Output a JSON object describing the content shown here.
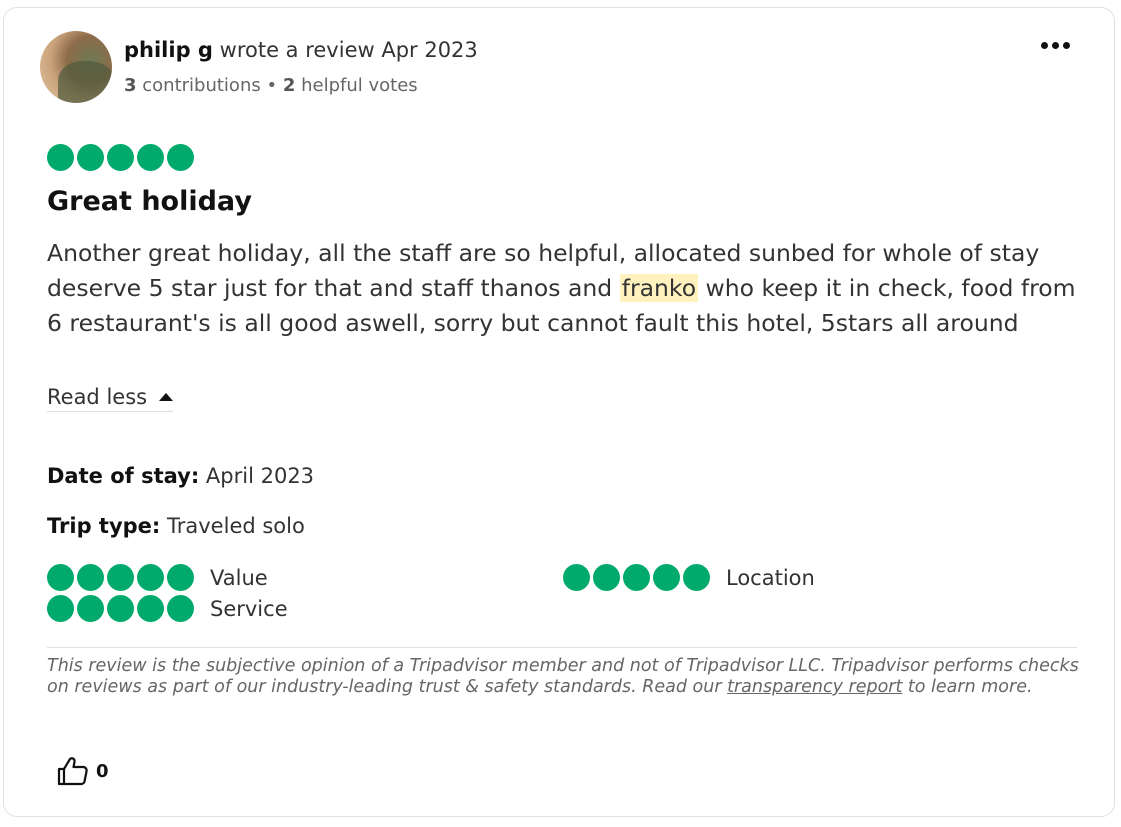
{
  "author": {
    "name": "philip g",
    "action": "wrote a review Apr 2023",
    "contributions_count": "3",
    "contributions_label": "contributions",
    "separator": "•",
    "helpful_votes_count": "2",
    "helpful_votes_label": "helpful votes",
    "avatar_icon": "user-avatar-photo"
  },
  "menu": {
    "icon": "more-options-icon"
  },
  "review": {
    "rating": 5,
    "rating_max": 5,
    "title": "Great holiday",
    "body_part1": "Another great holiday, all the staff are so helpful, allocated sunbed for whole of stay deserve 5 star just for that and staff thanos and ",
    "body_highlight": "franko",
    "body_part2": " who keep it in check, food from 6 restaurant's is all good aswell, sorry but cannot fault this hotel, 5stars all around",
    "read_less_label": "Read less"
  },
  "stay": {
    "date_label": "Date of stay:",
    "date_value": "April 2023",
    "trip_label": "Trip type:",
    "trip_value": "Traveled solo"
  },
  "sub_ratings": [
    {
      "label": "Value",
      "rating": 5
    },
    {
      "label": "Location",
      "rating": 5
    },
    {
      "label": "Service",
      "rating": 5
    }
  ],
  "disclaimer": {
    "text_before": "This review is the subjective opinion of a Tripadvisor member and not of Tripadvisor LLC. Tripadvisor performs checks on reviews as part of our industry-leading trust & safety standards. Read our ",
    "link_text": "transparency report",
    "text_after": " to learn more."
  },
  "helpful": {
    "icon": "thumbs-up-icon",
    "count": "0"
  },
  "colors": {
    "bubble": "#00aa6c",
    "highlight": "#fff2bf",
    "text": "#333333"
  }
}
